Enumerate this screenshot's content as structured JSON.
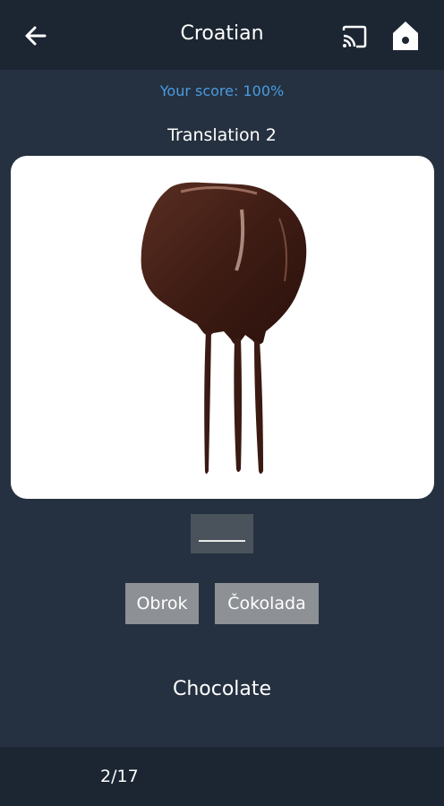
{
  "header": {
    "title": "Croatian",
    "back_icon": "arrow-left-icon",
    "cast_icon": "cast-icon",
    "home_icon": "home-icon"
  },
  "score_text": "Your score: 100%",
  "subtitle": "Translation 2",
  "image": {
    "subject": "chocolate-dipped cube dripping"
  },
  "answer_slot": {
    "value": ""
  },
  "choices": [
    "Obrok",
    "Čokolada"
  ],
  "prompt_word": "Chocolate",
  "progress": "2/17",
  "colors": {
    "background": "#253140",
    "bar": "#1c2632",
    "score": "#4a9be0",
    "choice": "#8d9094",
    "slot": "#4a525b"
  }
}
